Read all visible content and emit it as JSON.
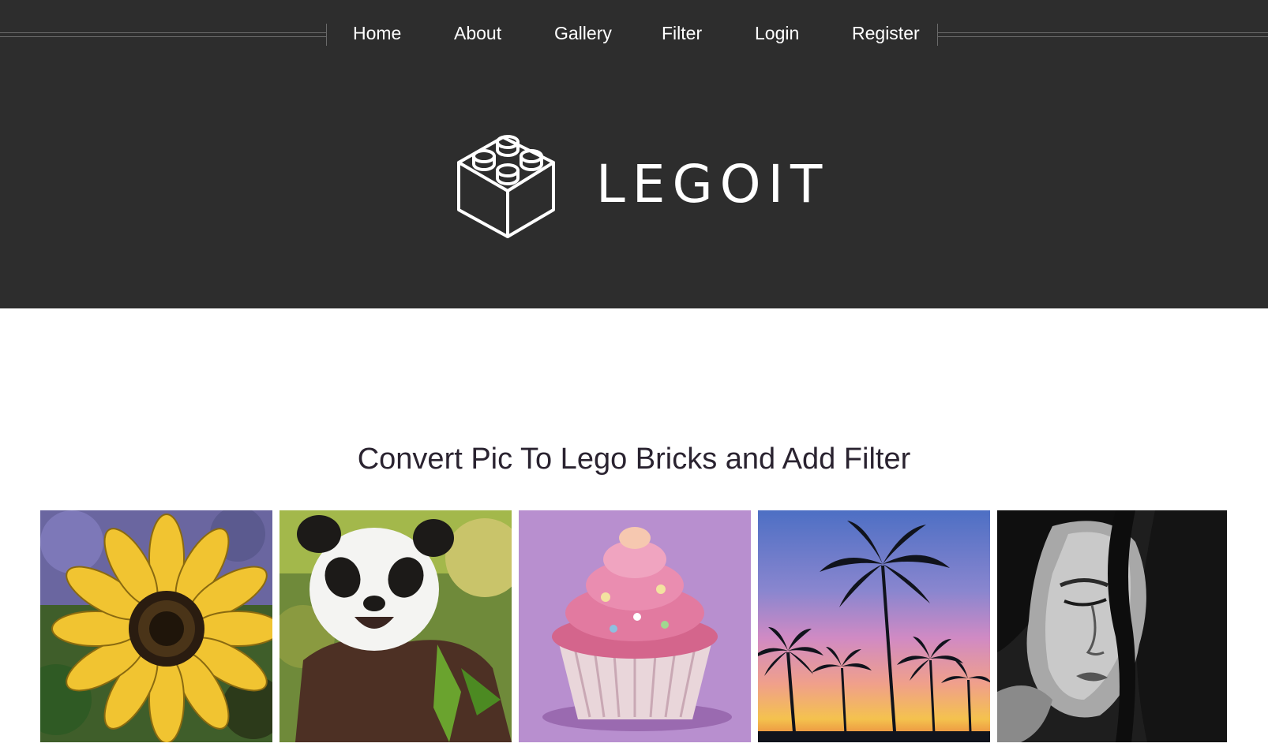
{
  "nav": {
    "items": [
      {
        "label": "Home"
      },
      {
        "label": "About"
      },
      {
        "label": "Gallery"
      },
      {
        "label": "Filter"
      },
      {
        "label": "Login"
      },
      {
        "label": "Register"
      }
    ]
  },
  "brand": {
    "name": "LEGOIT",
    "logo_icon": "lego-brick-icon"
  },
  "hero": {
    "heading": "Convert Pic To Lego Bricks and Add Filter"
  },
  "gallery": {
    "tiles": [
      {
        "subject": "sunflower"
      },
      {
        "subject": "panda"
      },
      {
        "subject": "cupcake"
      },
      {
        "subject": "palm-trees-sunset"
      },
      {
        "subject": "woman-portrait-grayscale"
      }
    ]
  },
  "colors": {
    "header_bg": "#2d2d2d",
    "nav_text": "#ffffff",
    "heading_text": "#2a2330"
  }
}
